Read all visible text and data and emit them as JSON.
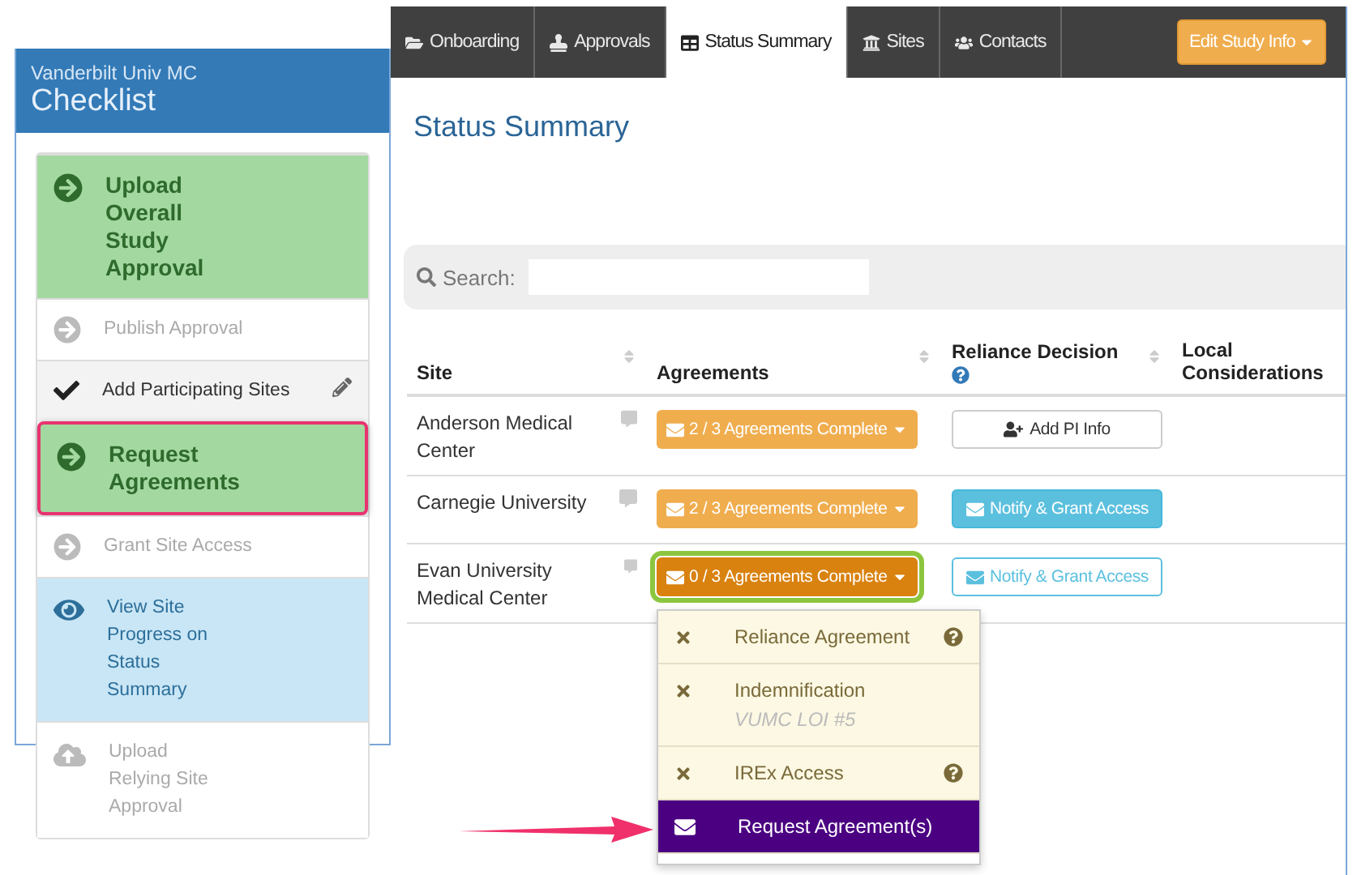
{
  "sidebar": {
    "subtitle": "Vanderbilt Univ MC",
    "title": "Checklist",
    "items": [
      {
        "label": "Upload Overall Study Approval",
        "kind": "current",
        "highlighted": false
      },
      {
        "label": "Publish Approval",
        "kind": "pending",
        "highlighted": false
      },
      {
        "label": "Add Participating Sites",
        "kind": "done",
        "highlighted": false
      },
      {
        "label": "Request Agreements",
        "kind": "current",
        "highlighted": true
      },
      {
        "label": "Grant Site Access",
        "kind": "pending",
        "highlighted": false
      },
      {
        "label": "View Site Progress on Status Summary",
        "kind": "view",
        "highlighted": false
      },
      {
        "label": "Upload Relying Site Approval",
        "kind": "upload",
        "highlighted": false
      }
    ]
  },
  "tabs": [
    {
      "label": "Onboarding",
      "selected": false
    },
    {
      "label": "Approvals",
      "selected": false
    },
    {
      "label": "Status Summary",
      "selected": true
    },
    {
      "label": "Sites",
      "selected": false
    },
    {
      "label": "Contacts",
      "selected": false
    }
  ],
  "edit_button": "Edit Study Info",
  "heading": "Status Summary",
  "search": {
    "label": "Search:"
  },
  "table": {
    "columns": [
      {
        "label": "Site",
        "sortable": true
      },
      {
        "label": "Agreements",
        "sortable": true
      },
      {
        "label": "Reliance Decision",
        "sortable": true,
        "help": true
      },
      {
        "label": "Local Considerations",
        "sortable": false
      }
    ],
    "rows": [
      {
        "site": "Anderson Medical Center",
        "agreements": {
          "label": "2 / 3 Agreements Complete",
          "kind": "partial",
          "highlighted": false
        },
        "reliance": {
          "label": "Add PI Info",
          "kind": "add-pi"
        }
      },
      {
        "site": "Carnegie University",
        "agreements": {
          "label": "2 / 3 Agreements Complete",
          "kind": "partial",
          "highlighted": false
        },
        "reliance": {
          "label": "Notify & Grant Access",
          "kind": "notify"
        }
      },
      {
        "site": "Evan University Medical Center",
        "agreements": {
          "label": "0 / 3 Agreements Complete",
          "kind": "none",
          "highlighted": true
        },
        "reliance": {
          "label": "Notify & Grant Access",
          "kind": "notify-outline"
        }
      }
    ]
  },
  "dropdown": {
    "items": [
      {
        "label": "Reliance Agreement",
        "kind": "missing",
        "help": true
      },
      {
        "label": "Indemnification",
        "note": "VUMC LOI #5",
        "kind": "missing",
        "help": false
      },
      {
        "label": "IREx Access",
        "kind": "missing",
        "help": true
      },
      {
        "label": "Request Agreement(s)",
        "kind": "action",
        "help": false
      }
    ]
  }
}
